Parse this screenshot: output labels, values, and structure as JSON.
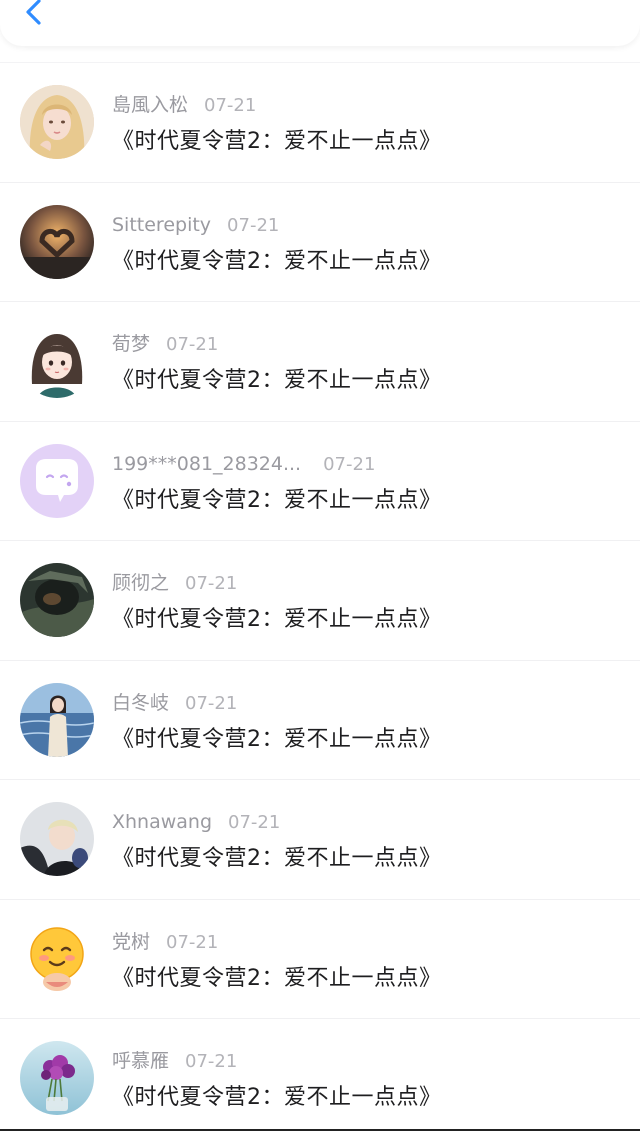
{
  "header": {
    "back_icon": "chevron-left-icon",
    "accent_color": "#2f8cff"
  },
  "comments": [
    {
      "user": "島風入松",
      "date": "07-21",
      "text": "《时代夏令营2：爱不止一点点》",
      "avatar": "avatar-blonde-girl"
    },
    {
      "user": "Sitterepity",
      "date": "07-21",
      "text": "《时代夏令营2：爱不止一点点》",
      "avatar": "avatar-heart-hands-sunset"
    },
    {
      "user": "荀梦",
      "date": "07-21",
      "text": "《时代夏令营2：爱不止一点点》",
      "avatar": "avatar-cartoon-girl"
    },
    {
      "user": "199***081_28324...",
      "date": "07-21",
      "text": "《时代夏令营2：爱不止一点点》",
      "avatar": "avatar-default-chat-bubble"
    },
    {
      "user": "顾彻之",
      "date": "07-21",
      "text": "《时代夏令营2：爱不止一点点》",
      "avatar": "avatar-dark-helmet"
    },
    {
      "user": "白冬岐",
      "date": "07-21",
      "text": "《时代夏令营2：爱不止一点点》",
      "avatar": "avatar-girl-by-sea"
    },
    {
      "user": "Xhnawang",
      "date": "07-21",
      "text": "《时代夏令营2：爱不止一点点》",
      "avatar": "avatar-boy-with-hat"
    },
    {
      "user": "党树",
      "date": "07-21",
      "text": "《时代夏令营2：爱不止一点点》",
      "avatar": "avatar-blushing-emoji"
    },
    {
      "user": "呼慕雁",
      "date": "07-21",
      "text": "《时代夏令营2：爱不止一点点》",
      "avatar": "avatar-purple-flowers"
    }
  ]
}
